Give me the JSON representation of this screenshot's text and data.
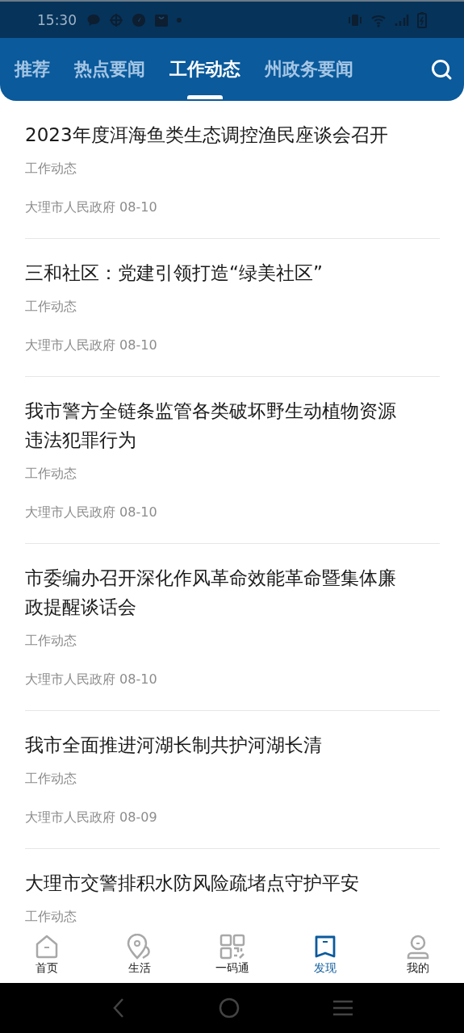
{
  "status_bar": {
    "time": "15:30"
  },
  "tabs": [
    {
      "label": "推荐",
      "selected": false
    },
    {
      "label": "热点要闻",
      "selected": false
    },
    {
      "label": "工作动态",
      "selected": true
    },
    {
      "label": "州政务要闻",
      "selected": false
    }
  ],
  "articles": [
    {
      "title": "2023年度洱海鱼类生态调控渔民座谈会召开",
      "category": "工作动态",
      "source": "大理市人民政府 08-10"
    },
    {
      "title": "三和社区：党建引领打造“绿美社区”",
      "category": "工作动态",
      "source": "大理市人民政府 08-10"
    },
    {
      "title": "我市警方全链条监管各类破坏野生动植物资源违法犯罪行为",
      "category": "工作动态",
      "source": "大理市人民政府 08-10"
    },
    {
      "title": "市委编办召开深化作风革命效能革命暨集体廉政提醒谈话会",
      "category": "工作动态",
      "source": "大理市人民政府 08-10"
    },
    {
      "title": "我市全面推进河湖长制共护河湖长清",
      "category": "工作动态",
      "source": "大理市人民政府 08-09"
    },
    {
      "title": "大理市交警排积水防风险疏堵点守护平安",
      "category": "工作动态"
    }
  ],
  "bottom_nav": [
    {
      "label": "首页",
      "kind": "home",
      "selected": false
    },
    {
      "label": "生活",
      "kind": "life",
      "selected": false
    },
    {
      "label": "一码通",
      "kind": "code",
      "selected": false
    },
    {
      "label": "发现",
      "kind": "discover",
      "selected": true
    },
    {
      "label": "我的",
      "kind": "me",
      "selected": false
    }
  ]
}
